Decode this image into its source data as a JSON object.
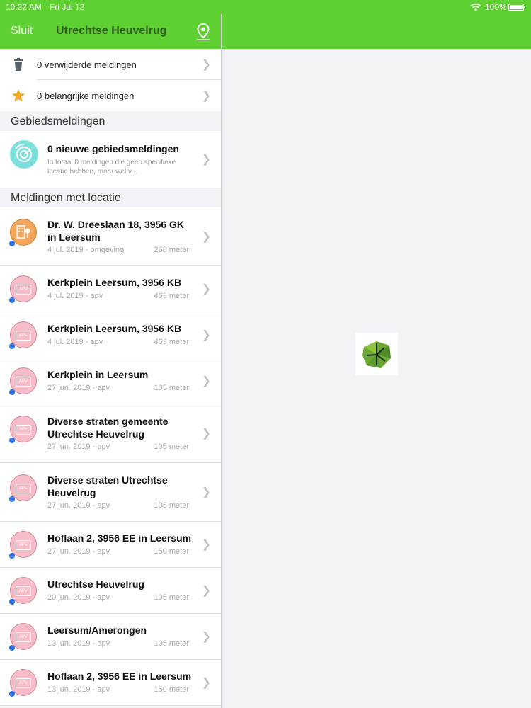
{
  "status_bar": {
    "time": "10:22 AM",
    "date": "Fri Jul 12",
    "battery": "100%"
  },
  "nav": {
    "close_label": "Sluit",
    "title": "Utrechtse Heuvelrug"
  },
  "quick_rows": [
    {
      "label": "0 verwijderde meldingen",
      "icon": "trash-icon"
    },
    {
      "label": "0 belangrijke meldingen",
      "icon": "star-icon"
    }
  ],
  "sections": {
    "area": "Gebiedsmeldingen",
    "location": "Meldingen met locatie"
  },
  "area_row": {
    "title": "0 nieuwe gebiedsmeldingen",
    "subtitle": "In totaal 0 meldingen die geen specifieke locatie hebben, maar wel v...",
    "icon": "radar-icon"
  },
  "notifications": [
    {
      "title": "Dr. W. Dreeslaan 18, 3956 GK in Leersum",
      "date": "4 jul. 2019 - omgeving",
      "distance": "268 meter",
      "icon": "building-icon",
      "color": "#f4a75c"
    },
    {
      "title": "Kerkplein Leersum, 3956 KB",
      "date": "4 jul. 2019 - apv",
      "distance": "463 meter",
      "icon": "apv-icon",
      "badge": "APV",
      "color": "#f6bcc8"
    },
    {
      "title": "Kerkplein Leersum, 3956 KB",
      "date": "4 jul. 2019 - apv",
      "distance": "463 meter",
      "icon": "apv-icon",
      "badge": "APV",
      "color": "#f6bcc8"
    },
    {
      "title": "Kerkplein in Leersum",
      "date": "27 jun. 2019 - apv",
      "distance": "105 meter",
      "icon": "apv-icon",
      "badge": "APV",
      "color": "#f6bcc8"
    },
    {
      "title": "Diverse straten gemeente Utrechtse Heuvelrug",
      "date": "27 jun. 2019 - apv",
      "distance": "105 meter",
      "icon": "apv-icon",
      "badge": "APV",
      "color": "#f6bcc8"
    },
    {
      "title": "Diverse straten Utrechtse Heuvelrug",
      "date": "27 jun. 2019 - apv",
      "distance": "105 meter",
      "icon": "apv-icon",
      "badge": "APV",
      "color": "#f6bcc8"
    },
    {
      "title": "Hoflaan 2, 3956 EE in Leersum",
      "date": "27 jun. 2019 - apv",
      "distance": "150 meter",
      "icon": "apv-icon",
      "badge": "APV",
      "color": "#f6bcc8"
    },
    {
      "title": "Utrechtse Heuvelrug",
      "date": "20 jun. 2019 - apv",
      "distance": "105 meter",
      "icon": "apv-icon",
      "badge": "APV",
      "color": "#f6bcc8"
    },
    {
      "title": "Leersum/Amerongen",
      "date": "13 jun. 2019 - apv",
      "distance": "105 meter",
      "icon": "apv-icon",
      "badge": "APV",
      "color": "#f6bcc8"
    },
    {
      "title": "Hoflaan 2, 3956 EE in Leersum",
      "date": "13 jun. 2019 - apv",
      "distance": "150 meter",
      "icon": "apv-icon",
      "badge": "APV",
      "color": "#f6bcc8"
    }
  ],
  "colors": {
    "brand_green": "#5fd032",
    "title_green": "#2f5d1e",
    "unread_dot": "#2f73e6"
  }
}
